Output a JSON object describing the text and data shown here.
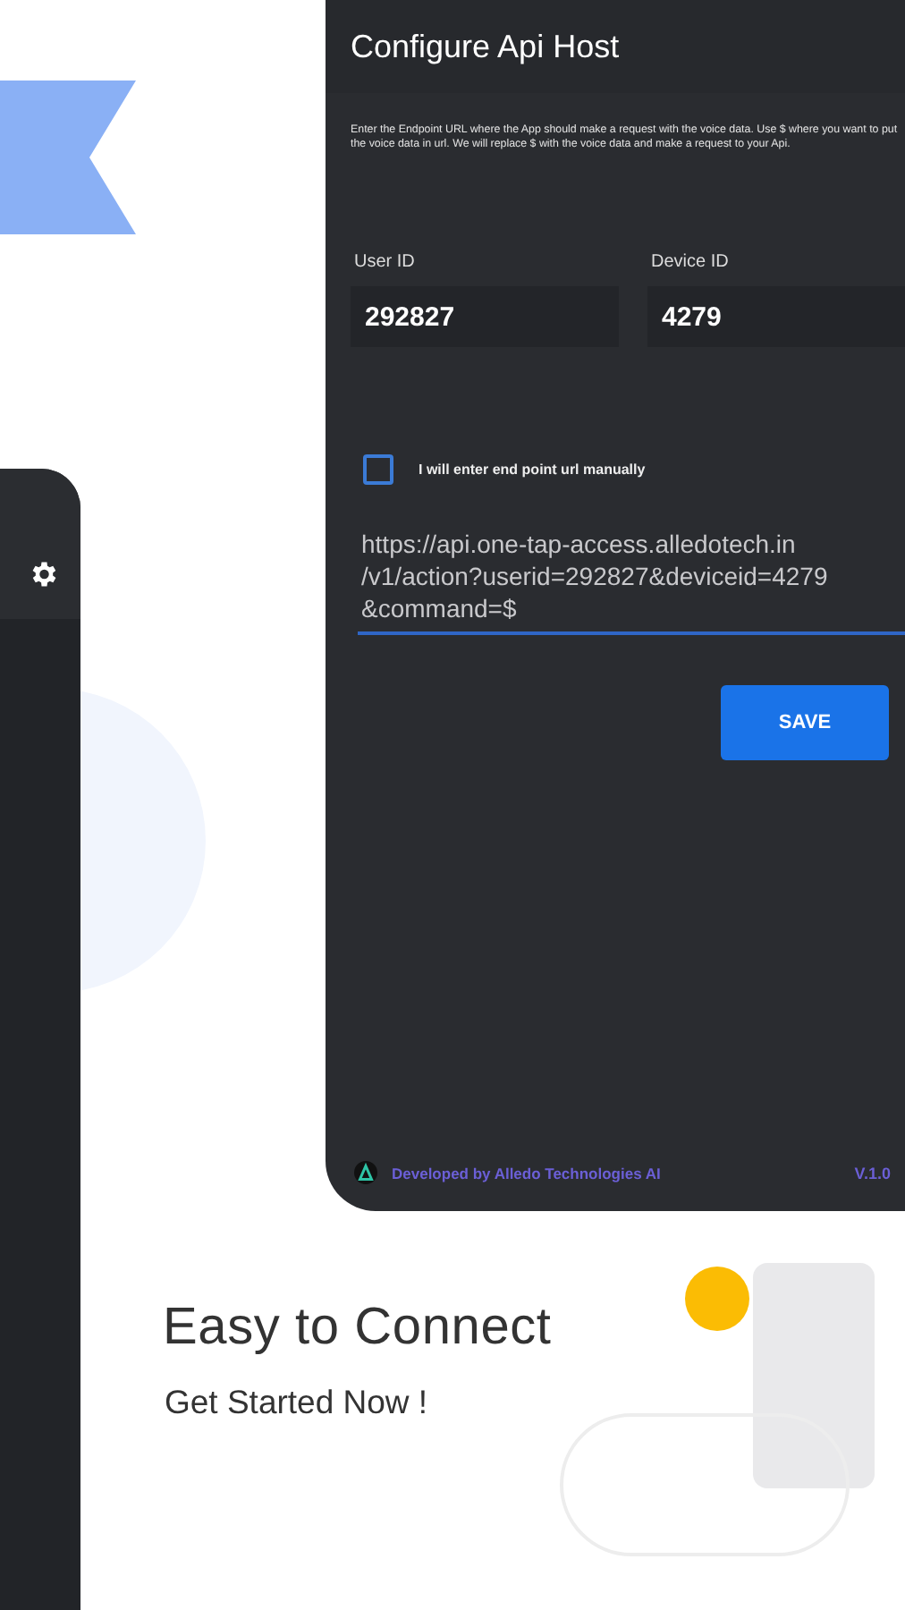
{
  "config_screen": {
    "title": "Configure Api Host",
    "description": "Enter the Endpoint URL where the App should make a request with the voice data. Use $ where you want to put the voice data in url. We will replace $ with the voice data and make a request to your Api.",
    "fields": [
      {
        "label": "User ID",
        "value": "292827"
      },
      {
        "label": "Device ID",
        "value": "4279"
      }
    ],
    "manual_checkbox": {
      "label": "I will enter end point url manually",
      "checked": false
    },
    "endpoint_url": {
      "value_lines": [
        "https://api.one-tap-access.alledotech.in",
        "/v1/action?userid=292827&deviceid=4279",
        "&command=$"
      ]
    },
    "save_button": "SAVE",
    "footer": {
      "developer": "Developed by Alledo Technologies AI",
      "version": "V.1.0"
    }
  },
  "promo": {
    "heading": "Easy to Connect",
    "subheading": "Get Started Now !"
  }
}
